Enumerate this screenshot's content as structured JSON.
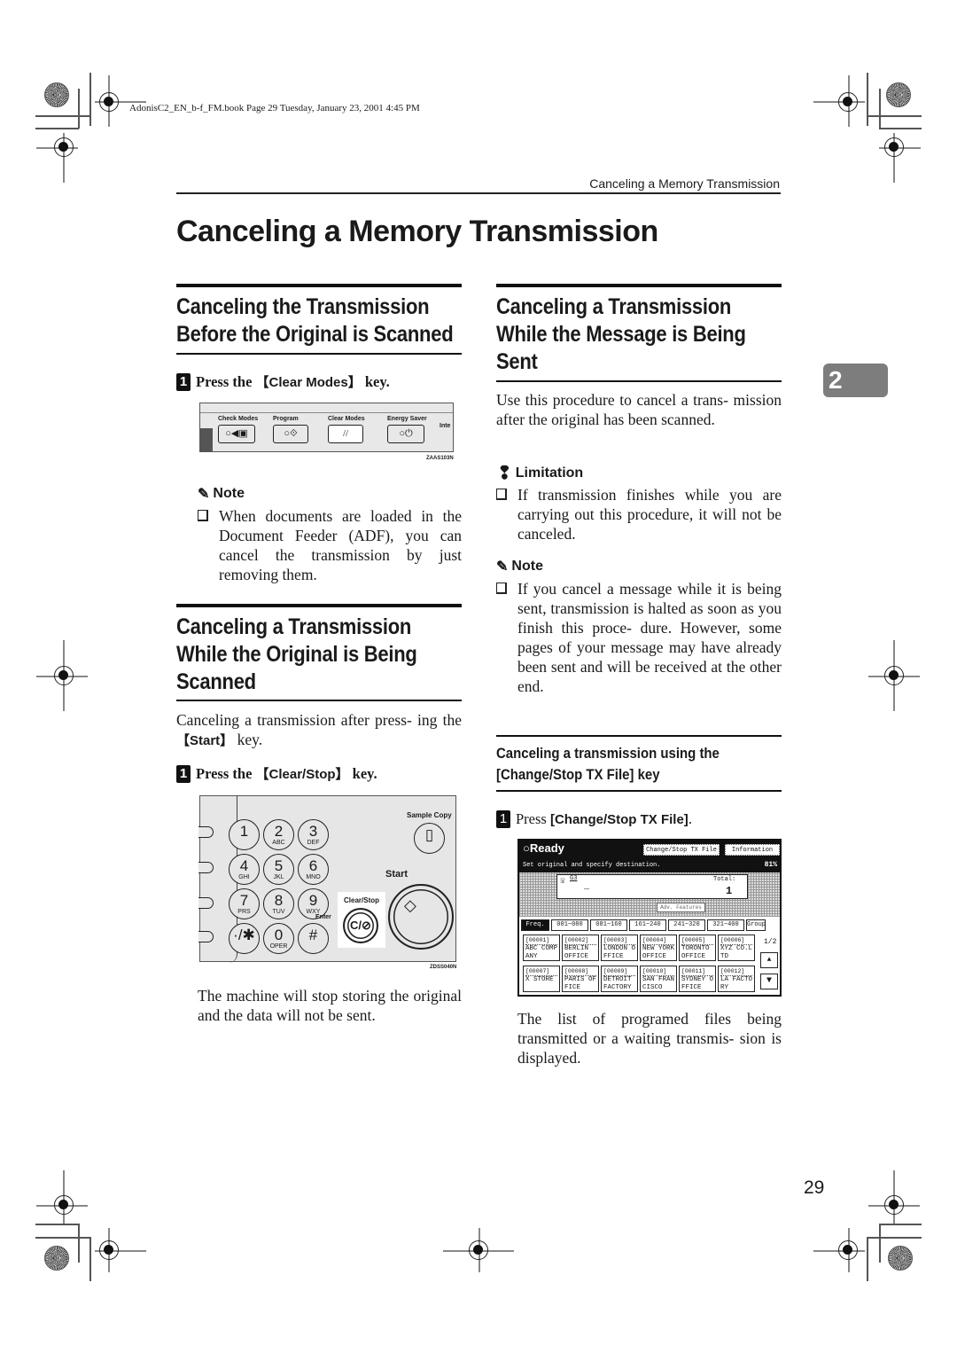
{
  "file_header": "AdonisC2_EN_b-f_FM.book  Page 29  Tuesday, January 23, 2001  4:45 PM",
  "running_head": "Canceling a Memory Transmission",
  "page_title": "Canceling a Memory Transmission",
  "chapter_tab": "2",
  "page_number": "29",
  "left_column": {
    "section1": {
      "title_line1": "Canceling the Transmission",
      "title_line2": "Before the Original is Scanned",
      "step": {
        "number": "1",
        "prefix": "Press the ",
        "key": "【Clear Modes】",
        "suffix": " key."
      },
      "figure": {
        "labels": [
          "Check  Modes",
          "Program",
          "Clear  Modes",
          "Energy  Saver",
          "Inte"
        ],
        "code": "ZAAS103N"
      },
      "note": {
        "heading": "Note",
        "bullets": [
          "When documents are loaded in the Document Feeder (ADF), you can cancel the transmission by just removing them."
        ]
      }
    },
    "section2": {
      "title_line1": "Canceling a Transmission",
      "title_line2": "While the Original is Being",
      "title_line3": "Scanned",
      "intro_pre": "Canceling a transmission after press- ing the ",
      "intro_key": "【Start】",
      "intro_post": " key.",
      "step": {
        "number": "1",
        "prefix": "Press the ",
        "key": "【Clear/Stop】",
        "suffix": " key."
      },
      "figure": {
        "keys": [
          {
            "n": "1",
            "l": ""
          },
          {
            "n": "2",
            "l": "ABC"
          },
          {
            "n": "3",
            "l": "DEF"
          },
          {
            "n": "4",
            "l": "GHI"
          },
          {
            "n": "5",
            "l": "JKL"
          },
          {
            "n": "6",
            "l": "MNO"
          },
          {
            "n": "7",
            "l": "PRS"
          },
          {
            "n": "8",
            "l": "TUV"
          },
          {
            "n": "9",
            "l": "WXY"
          },
          {
            "n": "·/✱",
            "l": ""
          },
          {
            "n": "0",
            "l": "OPER"
          },
          {
            "n": "#",
            "l": ""
          }
        ],
        "sample_copy_label": "Sample  Copy",
        "start_label": "Start",
        "clear_stop_label": "Clear/Stop",
        "enter_label": "Enter",
        "clear_stop_glyph": "C/⊘",
        "code": "ZDSS040N"
      },
      "result": "The machine will stop storing the original and the data will not be sent."
    }
  },
  "right_column": {
    "section3": {
      "title_line1": "Canceling a Transmission",
      "title_line2": "While the Message is Being",
      "title_line3": "Sent",
      "intro": "Use this procedure to cancel a trans- mission after the original has been scanned.",
      "limitation": {
        "heading": "Limitation",
        "bullets": [
          "If transmission finishes while you are carrying out this procedure, it will not be canceled."
        ]
      },
      "note": {
        "heading": "Note",
        "bullets": [
          "If you cancel a message while it is being sent, transmission is halted as soon as you finish this proce- dure. However, some pages of your message may have already been sent and will be received at the other end."
        ]
      }
    },
    "subsection": {
      "title_line1": "Canceling a transmission using the",
      "title_line2": "[Change/Stop TX File] key",
      "step": {
        "number": "1",
        "prefix": "Press ",
        "key": "[Change/Stop TX File]",
        "suffix": "."
      },
      "screen": {
        "status": "○Ready",
        "change_stop_button": "Change/Stop TX File",
        "information_button": "Information",
        "message": "Set original and specify destination.",
        "memory": "81%",
        "line_mode": "G3",
        "total_label": "Total:",
        "total_value": "1",
        "adv_features": "Adv. Features",
        "tabs": [
          "Freq.",
          "001~080",
          "081~160",
          "161~240",
          "241~320",
          "321~400",
          "Group"
        ],
        "destinations": [
          {
            "id": "[00001]",
            "name": "ABC COMP ANY"
          },
          {
            "id": "[00002]",
            "name": "BERLIN OFFICE"
          },
          {
            "id": "[00003]",
            "name": "LONDON O FFICE"
          },
          {
            "id": "[00004]",
            "name": "NEW YORK OFFICE"
          },
          {
            "id": "[00005]",
            "name": "TORONTO OFFICE"
          },
          {
            "id": "[00006]",
            "name": "XYZ CO.L TD"
          },
          {
            "id": "[00007]",
            "name": "X STORE"
          },
          {
            "id": "[00008]",
            "name": "PARIS OF FICE"
          },
          {
            "id": "[00009]",
            "name": "DETROIT FACTORY"
          },
          {
            "id": "[00010]",
            "name": "SAN FRAN CISCO"
          },
          {
            "id": "[00011]",
            "name": "SYDNEY O FFICE"
          },
          {
            "id": "[00012]",
            "name": "LA FACTO RY"
          }
        ],
        "page_indicator": "1/2",
        "up_arrow": "▲",
        "down_arrow": "▼"
      },
      "result": "The list of programed files being transmitted or a waiting transmis- sion is displayed."
    }
  }
}
